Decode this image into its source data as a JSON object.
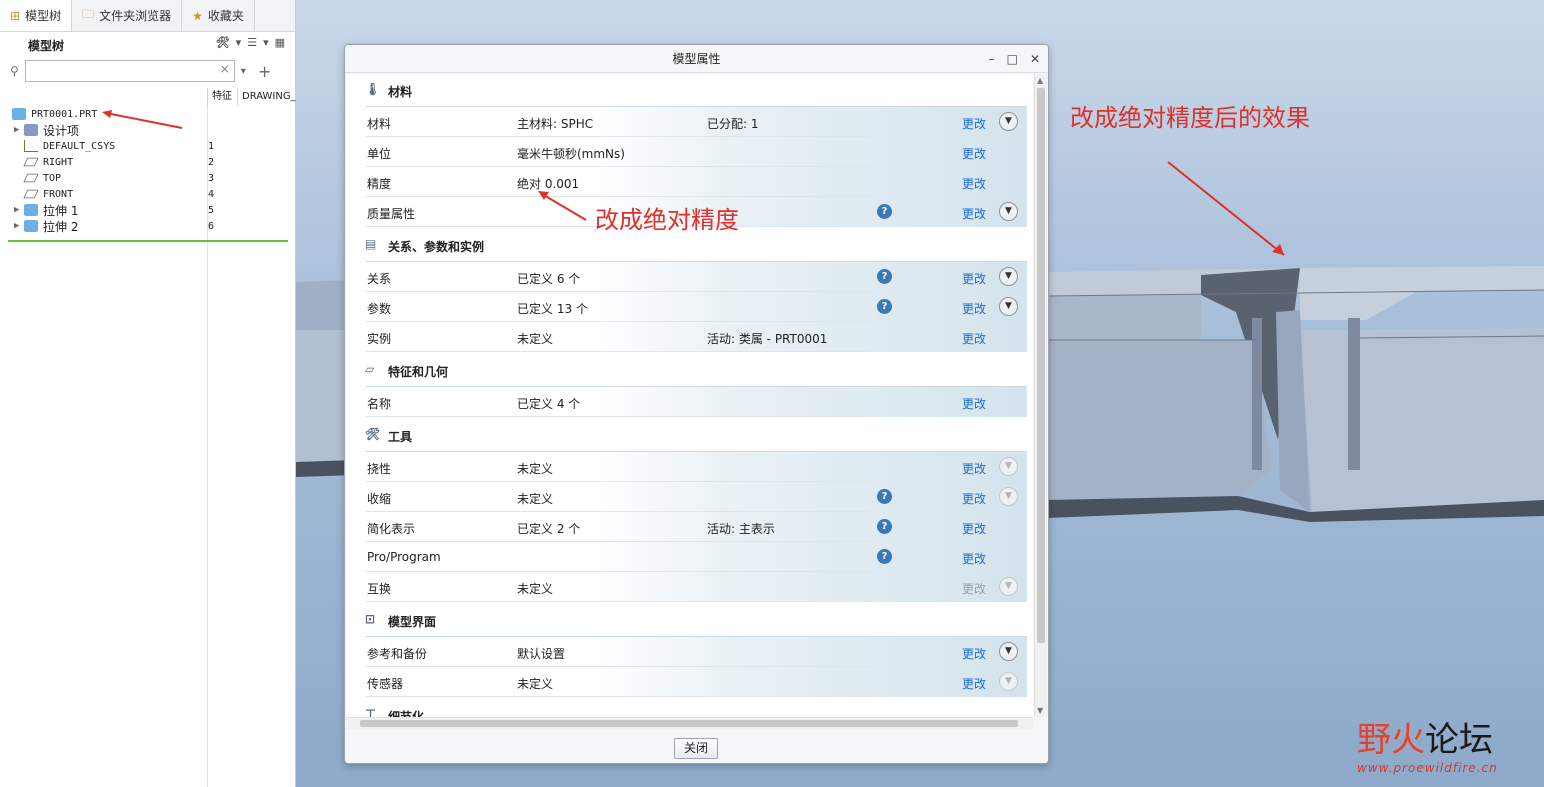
{
  "tabs": [
    {
      "label": "模型树",
      "icon": "tree-icon",
      "active": true
    },
    {
      "label": "文件夹浏览器",
      "icon": "folder-icon",
      "active": false
    },
    {
      "label": "收藏夹",
      "icon": "favorites-icon",
      "active": false
    }
  ],
  "tree_panel": {
    "title": "模型树",
    "columns": [
      "特征",
      "DRAWING_"
    ],
    "items": [
      {
        "label": "PRT0001.PRT",
        "num": "",
        "icon": "part-icon",
        "expandable": false,
        "indent": 0
      },
      {
        "label": "设计项",
        "num": "",
        "icon": "design-item-icon",
        "expandable": true,
        "indent": 1
      },
      {
        "label": "DEFAULT_CSYS",
        "num": "1",
        "icon": "csys-icon",
        "expandable": false,
        "indent": 1
      },
      {
        "label": "RIGHT",
        "num": "2",
        "icon": "datum-plane-icon",
        "expandable": false,
        "indent": 1
      },
      {
        "label": "TOP",
        "num": "3",
        "icon": "datum-plane-icon",
        "expandable": false,
        "indent": 1
      },
      {
        "label": "FRONT",
        "num": "4",
        "icon": "datum-plane-icon",
        "expandable": false,
        "indent": 1
      },
      {
        "label": "拉伸 1",
        "num": "5",
        "icon": "extrude-icon",
        "expandable": true,
        "indent": 1
      },
      {
        "label": "拉伸 2",
        "num": "6",
        "icon": "extrude-icon",
        "expandable": true,
        "indent": 1
      }
    ]
  },
  "dialog": {
    "title": "模型属性",
    "close_label": "关闭",
    "change_label": "更改",
    "sections": [
      {
        "title": "材料",
        "icon": "material-icon",
        "rows": [
          {
            "label": "材料",
            "value": "主材料: SPHC",
            "value2": "已分配: 1",
            "help": false,
            "change_enabled": true,
            "expand": "active"
          },
          {
            "label": "单位",
            "value": "毫米牛顿秒(mmNs)",
            "value2": "",
            "help": false,
            "change_enabled": true,
            "expand": "none"
          },
          {
            "label": "精度",
            "value": "绝对 0.001",
            "value2": "",
            "help": false,
            "change_enabled": true,
            "expand": "none"
          },
          {
            "label": "质量属性",
            "value": "",
            "value2": "",
            "help": true,
            "change_enabled": true,
            "expand": "active"
          }
        ]
      },
      {
        "title": "关系、参数和实例",
        "icon": "relations-icon",
        "rows": [
          {
            "label": "关系",
            "value": "已定义 6 个",
            "value2": "",
            "help": true,
            "change_enabled": true,
            "expand": "active"
          },
          {
            "label": "参数",
            "value": "已定义 13 个",
            "value2": "",
            "help": true,
            "change_enabled": true,
            "expand": "active"
          },
          {
            "label": "实例",
            "value": "未定义",
            "value2": "活动: 类属 - PRT0001",
            "help": false,
            "change_enabled": true,
            "expand": "none"
          }
        ]
      },
      {
        "title": "特征和几何",
        "icon": "feature-icon",
        "rows": [
          {
            "label": "名称",
            "value": "已定义 4 个",
            "value2": "",
            "help": false,
            "change_enabled": true,
            "expand": "none"
          }
        ]
      },
      {
        "title": "工具",
        "icon": "tools-icon",
        "rows": [
          {
            "label": "挠性",
            "value": "未定义",
            "value2": "",
            "help": false,
            "change_enabled": true,
            "expand": "disabled"
          },
          {
            "label": "收缩",
            "value": "未定义",
            "value2": "",
            "help": true,
            "change_enabled": true,
            "expand": "disabled"
          },
          {
            "label": "简化表示",
            "value": "已定义 2 个",
            "value2": "活动: 主表示",
            "help": true,
            "change_enabled": true,
            "expand": "none"
          },
          {
            "label": "Pro/Program",
            "value": "",
            "value2": "",
            "help": true,
            "change_enabled": true,
            "expand": "none"
          },
          {
            "label": "互换",
            "value": "未定义",
            "value2": "",
            "help": false,
            "change_enabled": false,
            "expand": "disabled"
          }
        ]
      },
      {
        "title": "模型界面",
        "icon": "interface-icon",
        "rows": [
          {
            "label": "参考和备份",
            "value": "默认设置",
            "value2": "",
            "help": false,
            "change_enabled": true,
            "expand": "active"
          },
          {
            "label": "传感器",
            "value": "未定义",
            "value2": "",
            "help": false,
            "change_enabled": true,
            "expand": "disabled"
          }
        ]
      },
      {
        "title": "细节化",
        "icon": "detail-icon",
        "rows": []
      }
    ]
  },
  "annotations": {
    "precision_note": "改成绝对精度",
    "effect_note": "改成绝对精度后的效果"
  },
  "watermark": {
    "part1": "野火",
    "part2": "论坛",
    "url": "www.proewildfire.cn"
  },
  "colors": {
    "link": "#1a6fc9",
    "annotation": "#e0302a",
    "model_face": "#a6b3c8"
  }
}
